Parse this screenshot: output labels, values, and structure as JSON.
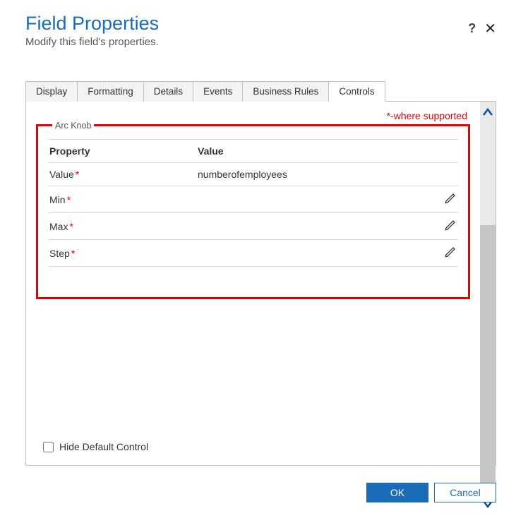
{
  "header": {
    "title": "Field Properties",
    "subtitle": "Modify this field's properties.",
    "help": "?",
    "close": "✕"
  },
  "tabs": {
    "items": [
      {
        "label": "Display"
      },
      {
        "label": "Formatting"
      },
      {
        "label": "Details"
      },
      {
        "label": "Events"
      },
      {
        "label": "Business Rules"
      },
      {
        "label": "Controls"
      }
    ],
    "activeIndex": 5
  },
  "note": "*-where supported",
  "panel": {
    "legend": "Arc Knob",
    "columns": {
      "prop": "Property",
      "val": "Value"
    },
    "rows": [
      {
        "prop": "Value",
        "required": true,
        "val": "numberofemployees",
        "editable": false
      },
      {
        "prop": "Min",
        "required": true,
        "val": "",
        "editable": true
      },
      {
        "prop": "Max",
        "required": true,
        "val": "",
        "editable": true
      },
      {
        "prop": "Step",
        "required": true,
        "val": "",
        "editable": true
      }
    ]
  },
  "checkbox": {
    "label": "Hide Default Control",
    "checked": false
  },
  "footer": {
    "ok": "OK",
    "cancel": "Cancel"
  }
}
